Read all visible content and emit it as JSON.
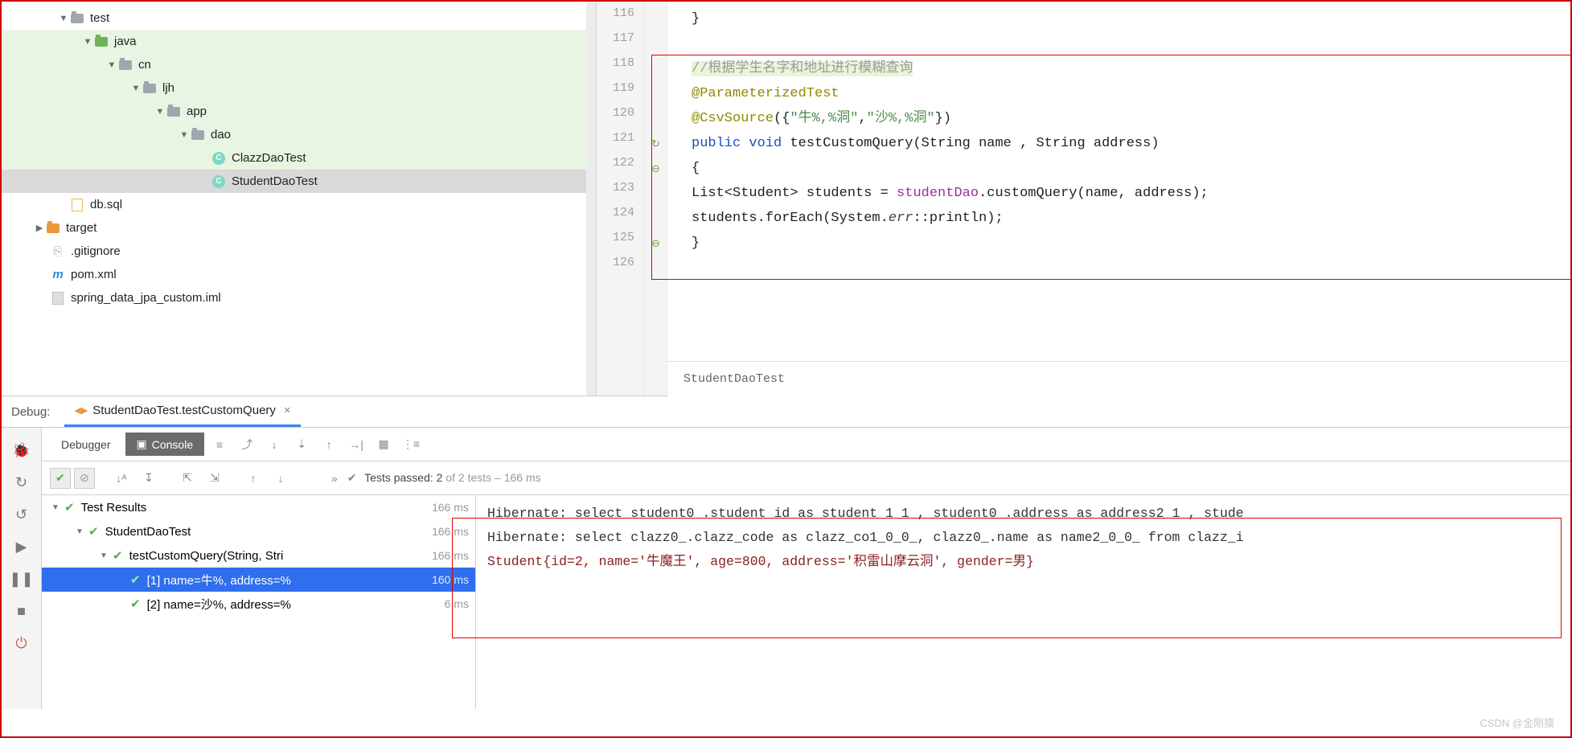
{
  "tree": {
    "test": "test",
    "java": "java",
    "cn": "cn",
    "ljh": "ljh",
    "app": "app",
    "dao": "dao",
    "clazzDaoTest": "ClazzDaoTest",
    "studentDaoTest": "StudentDaoTest",
    "dbsql": "db.sql",
    "target": "target",
    "gitignore": ".gitignore",
    "pom": "pom.xml",
    "iml": "spring_data_jpa_custom.iml"
  },
  "gutter": [
    "116",
    "117",
    "118",
    "119",
    "120",
    "121",
    "122",
    "123",
    "124",
    "125",
    "126"
  ],
  "code": {
    "l116": "        }",
    "l118_comment": "//根据学生名字和地址进行模糊查询",
    "l119": "@ParameterizedTest",
    "l120_a": "@CsvSource",
    "l120_b": "({",
    "l120_s1": "\"牛%,%洞\"",
    "l120_c": ",",
    "l120_s2": "\"沙%,%洞\"",
    "l120_d": "})",
    "l121_a": "public",
    "l121_b": " void ",
    "l121_c": "testCustomQuery",
    "l121_d": "(String name , String address)",
    "l122": "{",
    "l123_a": "    List<Student> students = ",
    "l123_b": "studentDao",
    "l123_c": ".customQuery(name, address);",
    "l124_a": "    students.forEach(System.",
    "l124_b": "err",
    "l124_c": "::println);",
    "l125": "}"
  },
  "breadcrumb": "StudentDaoTest",
  "debugTab": {
    "label": "Debug:",
    "title": "StudentDaoTest.testCustomQuery"
  },
  "tabs": {
    "debugger": "Debugger",
    "console": "Console"
  },
  "testStatus": {
    "prefix": "»",
    "ok": "✔",
    "label": "Tests passed:",
    "count": "2",
    "of": "of 2 tests – 166 ms"
  },
  "testTree": {
    "root": {
      "label": "Test Results",
      "time": "166 ms"
    },
    "cls": {
      "label": "StudentDaoTest",
      "time": "166 ms"
    },
    "method": {
      "label": "testCustomQuery(String, Stri",
      "time": "166 ms"
    },
    "r1": {
      "label": "[1] name=牛%, address=%",
      "time": "160 ms"
    },
    "r2": {
      "label": "[2] name=沙%, address=%",
      "time": "6 ms"
    }
  },
  "console": {
    "l1": "Hibernate: select student0_.student_id as student_1_1_, student0_.address as address2_1_, stude",
    "l2": "Hibernate: select clazz0_.clazz_code as clazz_co1_0_0_, clazz0_.name as name2_0_0_ from clazz_i",
    "l3": "Student{id=2, name='牛魔王', age=800, address='积雷山摩云洞', gender=男}"
  },
  "watermark": "CSDN @金刚猿"
}
